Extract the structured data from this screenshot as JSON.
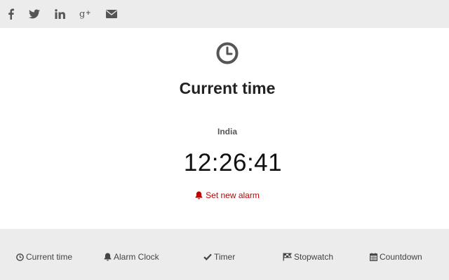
{
  "social": {
    "icons": [
      "facebook-icon",
      "twitter-icon",
      "linkedin-icon",
      "google-plus-icon",
      "envelope-icon"
    ]
  },
  "header": {
    "icon": "clock-icon",
    "title": "Current time"
  },
  "clock": {
    "location": "India",
    "time": "12:26:41"
  },
  "alarm": {
    "icon": "bell-icon",
    "label": "Set new alarm"
  },
  "nav": {
    "items": [
      {
        "icon": "clock-icon",
        "label": "Current time"
      },
      {
        "icon": "bell-icon",
        "label": "Alarm Clock"
      },
      {
        "icon": "check-icon",
        "label": "Timer"
      },
      {
        "icon": "flag-icon",
        "label": "Stopwatch"
      },
      {
        "icon": "calendar-icon",
        "label": "Countdown"
      }
    ]
  },
  "colors": {
    "bar_background": "#ececec",
    "icon_gray": "#555555",
    "alarm_red": "#c00000"
  }
}
